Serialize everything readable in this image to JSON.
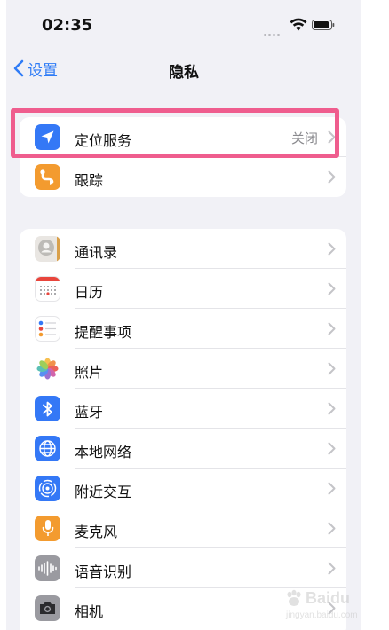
{
  "status_bar": {
    "time": "02:35"
  },
  "nav": {
    "back_label": "设置",
    "title": "隐私"
  },
  "group1": [
    {
      "label": "定位服务",
      "value": "关闭",
      "icon": "location-arrow-icon",
      "color": "#3478f6"
    },
    {
      "label": "跟踪",
      "icon": "tracking-icon",
      "color": "#f39b2f"
    }
  ],
  "group2": [
    {
      "label": "通讯录",
      "icon": "contacts-icon"
    },
    {
      "label": "日历",
      "icon": "calendar-icon"
    },
    {
      "label": "提醒事项",
      "icon": "reminders-icon"
    },
    {
      "label": "照片",
      "icon": "photos-icon"
    },
    {
      "label": "蓝牙",
      "icon": "bluetooth-icon",
      "color": "#3478f6"
    },
    {
      "label": "本地网络",
      "icon": "globe-icon",
      "color": "#3478f6"
    },
    {
      "label": "附近交互",
      "icon": "nearby-interactions-icon",
      "color": "#3478f6"
    },
    {
      "label": "麦克风",
      "icon": "microphone-icon",
      "color": "#f39b2f"
    },
    {
      "label": "语音识别",
      "icon": "speech-recognition-icon",
      "color": "#9a9aa0"
    },
    {
      "label": "相机",
      "icon": "camera-icon",
      "color": "#9a9aa0"
    }
  ],
  "watermark": {
    "text": "Baidu",
    "sub": "jingyan.baidu.com"
  }
}
